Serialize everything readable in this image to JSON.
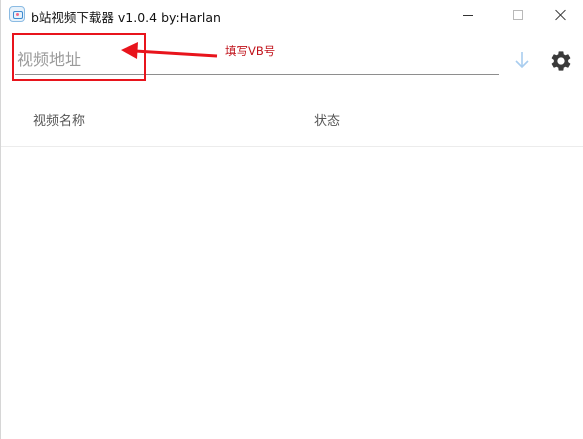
{
  "window": {
    "title": "b站视频下载器 v1.0.4 by:Harlan",
    "icon": "app-icon",
    "controls": [
      "minimize-icon",
      "maximize-icon",
      "close-icon"
    ]
  },
  "toolbar": {
    "url_input": {
      "placeholder": "视频地址",
      "value": ""
    },
    "download_icon": "arrow-down-icon",
    "settings_icon": "gear-icon"
  },
  "annotation": {
    "note": "填写VB号",
    "color": "#e8141c"
  },
  "table": {
    "columns": [
      "视频名称",
      "状态"
    ],
    "rows": []
  },
  "colors": {
    "accent_light_blue": "#a9cdef",
    "annotation_red": "#e8141c"
  }
}
